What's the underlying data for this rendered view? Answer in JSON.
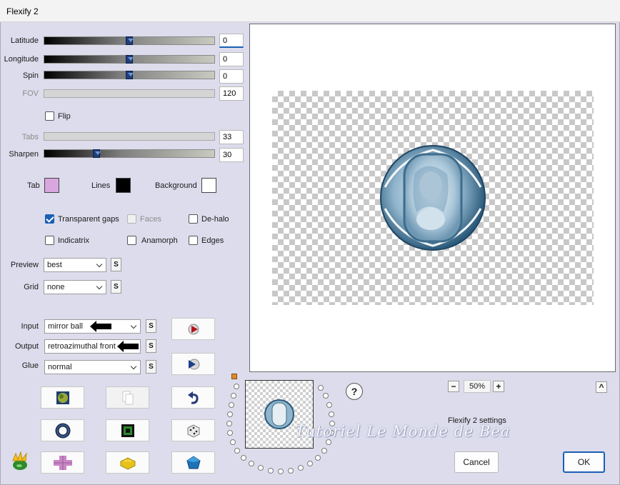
{
  "window": {
    "title": "Flexify 2"
  },
  "sliders": {
    "latitude": {
      "label": "Latitude",
      "value": "0",
      "level": 0.5
    },
    "longitude": {
      "label": "Longitude",
      "value": "0",
      "level": 0.5
    },
    "spin": {
      "label": "Spin",
      "value": "0",
      "level": 0.5
    },
    "fov": {
      "label": "FOV",
      "value": "120"
    },
    "tabs": {
      "label": "Tabs",
      "value": "33"
    },
    "sharpen": {
      "label": "Sharpen",
      "value": "30",
      "level": 0.3
    }
  },
  "flip": {
    "label": "Flip",
    "checked": false
  },
  "colors": {
    "tab": {
      "label": "Tab",
      "hex": "#d9a6e0"
    },
    "lines": {
      "label": "Lines",
      "hex": "#000000"
    },
    "background": {
      "label": "Background",
      "hex": "#ffffff"
    }
  },
  "options": {
    "transparent_gaps": {
      "label": "Transparent gaps",
      "checked": true
    },
    "faces": {
      "label": "Faces",
      "checked": false,
      "disabled": true
    },
    "de_halo": {
      "label": "De-halo",
      "checked": false
    },
    "indicatrix": {
      "label": "Indicatrix",
      "checked": false
    },
    "anamorph": {
      "label": "Anamorph",
      "checked": false
    },
    "edges": {
      "label": "Edges",
      "checked": false
    }
  },
  "preview_select": {
    "label": "Preview",
    "value": "best"
  },
  "grid_select": {
    "label": "Grid",
    "value": "none"
  },
  "input_select": {
    "label": "Input",
    "value": "mirror ball"
  },
  "output_select": {
    "label": "Output",
    "value": "retroazimuthal front"
  },
  "glue_select": {
    "label": "Glue",
    "value": "normal"
  },
  "s_button_label": "S",
  "zoom": {
    "value": "50%",
    "minus": "−",
    "plus": "+"
  },
  "help_label": "?",
  "scroll_up_label": "^",
  "settings_name": "Flexify 2 settings",
  "watermark": "Tutoriel Le Monde de Bea",
  "buttons": {
    "cancel": "Cancel",
    "ok": "OK"
  },
  "icons": {
    "play": "play-icon",
    "next": "skip-next-icon",
    "randomize": "randomize-planet-icon",
    "copy": "copy-icon",
    "undo": "undo-icon",
    "ring": "ring-icon",
    "square": "green-square-icon",
    "dice": "dice-icon",
    "logo": "flaming-pear-logo-icon",
    "cross": "tile-cross-icon",
    "brick": "lego-brick-icon",
    "gem": "gem-icon"
  }
}
